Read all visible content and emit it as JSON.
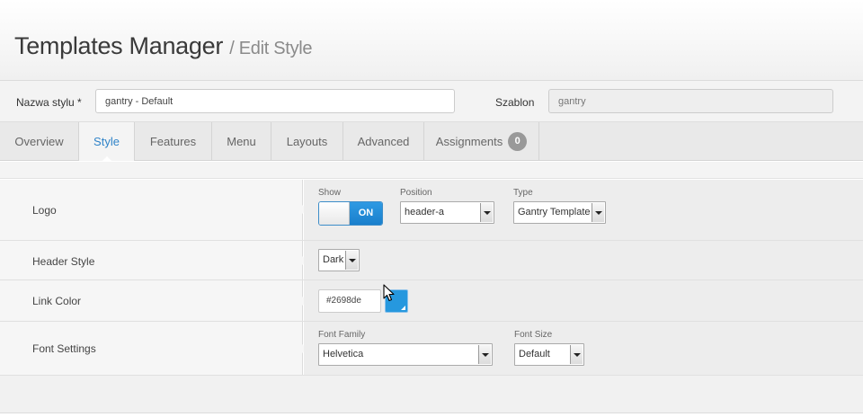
{
  "header": {
    "title": "Templates Manager",
    "subtitle": "/ Edit Style"
  },
  "namebar": {
    "style_name_label": "Nazwa stylu *",
    "style_name_value": "gantry - Default",
    "template_label": "Szablon",
    "template_value": "gantry"
  },
  "tabs": [
    {
      "label": "Overview"
    },
    {
      "label": "Style",
      "active": true
    },
    {
      "label": "Features"
    },
    {
      "label": "Menu"
    },
    {
      "label": "Layouts"
    },
    {
      "label": "Advanced"
    },
    {
      "label": "Assignments",
      "badge": "0"
    }
  ],
  "rows": {
    "logo": {
      "label": "Logo",
      "show_label": "Show",
      "toggle_text": "ON",
      "position_label": "Position",
      "position_value": "header-a",
      "type_label": "Type",
      "type_value": "Gantry Template"
    },
    "header_style": {
      "label": "Header Style",
      "value": "Dark"
    },
    "link_color": {
      "label": "Link Color",
      "value": "#2698de"
    },
    "font_settings": {
      "label": "Font Settings",
      "family_label": "Font Family",
      "family_value": "Helvetica",
      "size_label": "Font Size",
      "size_value": "Default"
    }
  },
  "colors": {
    "accent": "#2f83c8",
    "swatch": "#2698de",
    "toggle_on": "#1a7fcc"
  },
  "icons": {
    "cursor": "mouse-pointer-icon"
  }
}
